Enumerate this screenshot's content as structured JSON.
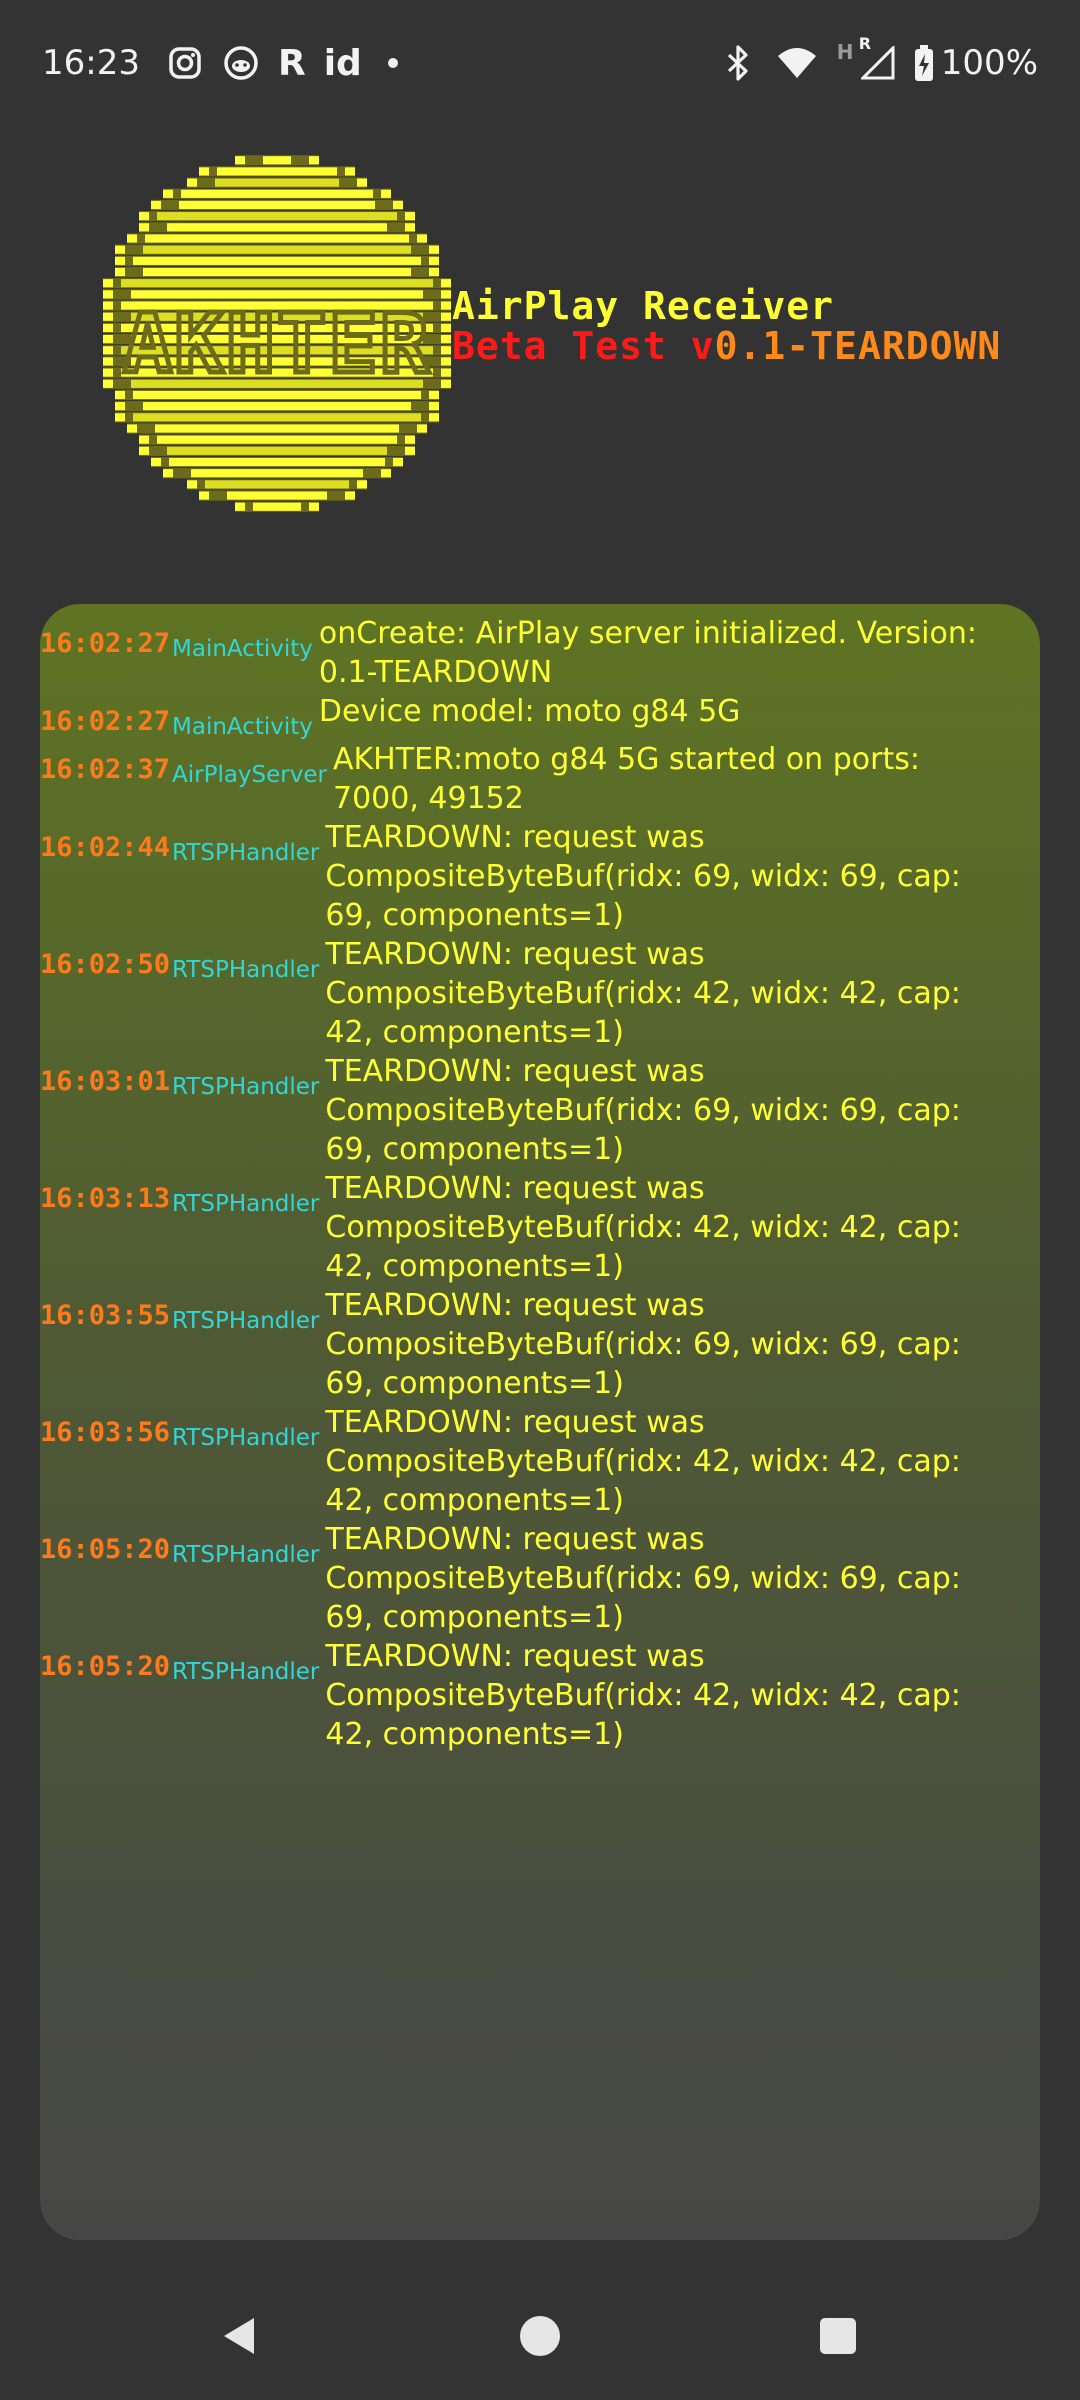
{
  "status_bar": {
    "time": "16:23",
    "icons_left": [
      "instagram-icon",
      "reddit-alien-icon",
      "r-app-icon",
      "id-app-icon",
      "notification-dot-icon"
    ],
    "r_text": "R",
    "id_text": "id",
    "icons_right": [
      "bluetooth-icon",
      "wifi-icon",
      "signal-hr-icon",
      "battery-charging-icon"
    ],
    "signal_h": "H",
    "signal_r": "R",
    "battery": "100%"
  },
  "header": {
    "logo_text": "AKHTER",
    "app_name": "AirPlay Receiver",
    "version_label": "Beta Test v",
    "version_number": "0.1-TEARDOWN",
    "colors": {
      "logo_yellow": "#ffff33",
      "logo_olive": "#6b6b1a",
      "red": "#ff1a1a",
      "orange": "#ff8a1a"
    }
  },
  "log": {
    "entries": [
      {
        "time": "16:02:27",
        "tag": "MainActivity",
        "message": "onCreate: AirPlay server initialized. Version: 0.1-TEARDOWN"
      },
      {
        "time": "16:02:27",
        "tag": "MainActivity",
        "message": "Device model: moto g84 5G"
      },
      {
        "time": "16:02:37",
        "tag": "AirPlayServer",
        "message": "AKHTER:moto g84 5G started on ports: 7000, 49152"
      },
      {
        "time": "16:02:44",
        "tag": "RTSPHandler",
        "message": "TEARDOWN: request was CompositeByteBuf(ridx: 69, widx: 69, cap: 69, components=1)"
      },
      {
        "time": "16:02:50",
        "tag": "RTSPHandler",
        "message": "TEARDOWN: request was CompositeByteBuf(ridx: 42, widx: 42, cap: 42, components=1)"
      },
      {
        "time": "16:03:01",
        "tag": "RTSPHandler",
        "message": "TEARDOWN: request was CompositeByteBuf(ridx: 69, widx: 69, cap: 69, components=1)"
      },
      {
        "time": "16:03:13",
        "tag": "RTSPHandler",
        "message": "TEARDOWN: request was CompositeByteBuf(ridx: 42, widx: 42, cap: 42, components=1)"
      },
      {
        "time": "16:03:55",
        "tag": "RTSPHandler",
        "message": "TEARDOWN: request was CompositeByteBuf(ridx: 69, widx: 69, cap: 69, components=1)"
      },
      {
        "time": "16:03:56",
        "tag": "RTSPHandler",
        "message": "TEARDOWN: request was CompositeByteBuf(ridx: 42, widx: 42, cap: 42, components=1)"
      },
      {
        "time": "16:05:20",
        "tag": "RTSPHandler",
        "message": "TEARDOWN: request was CompositeByteBuf(ridx: 69, widx: 69, cap: 69, components=1)"
      },
      {
        "time": "16:05:20",
        "tag": "RTSPHandler",
        "message": "TEARDOWN: request was CompositeByteBuf(ridx: 42, widx: 42, cap: 42, components=1)"
      }
    ],
    "colors": {
      "time": "#ff7a1a",
      "tag": "#33d6d6",
      "message": "#ffff33"
    }
  },
  "nav_bar": {
    "buttons": [
      "back-icon",
      "home-icon",
      "recents-icon"
    ]
  }
}
